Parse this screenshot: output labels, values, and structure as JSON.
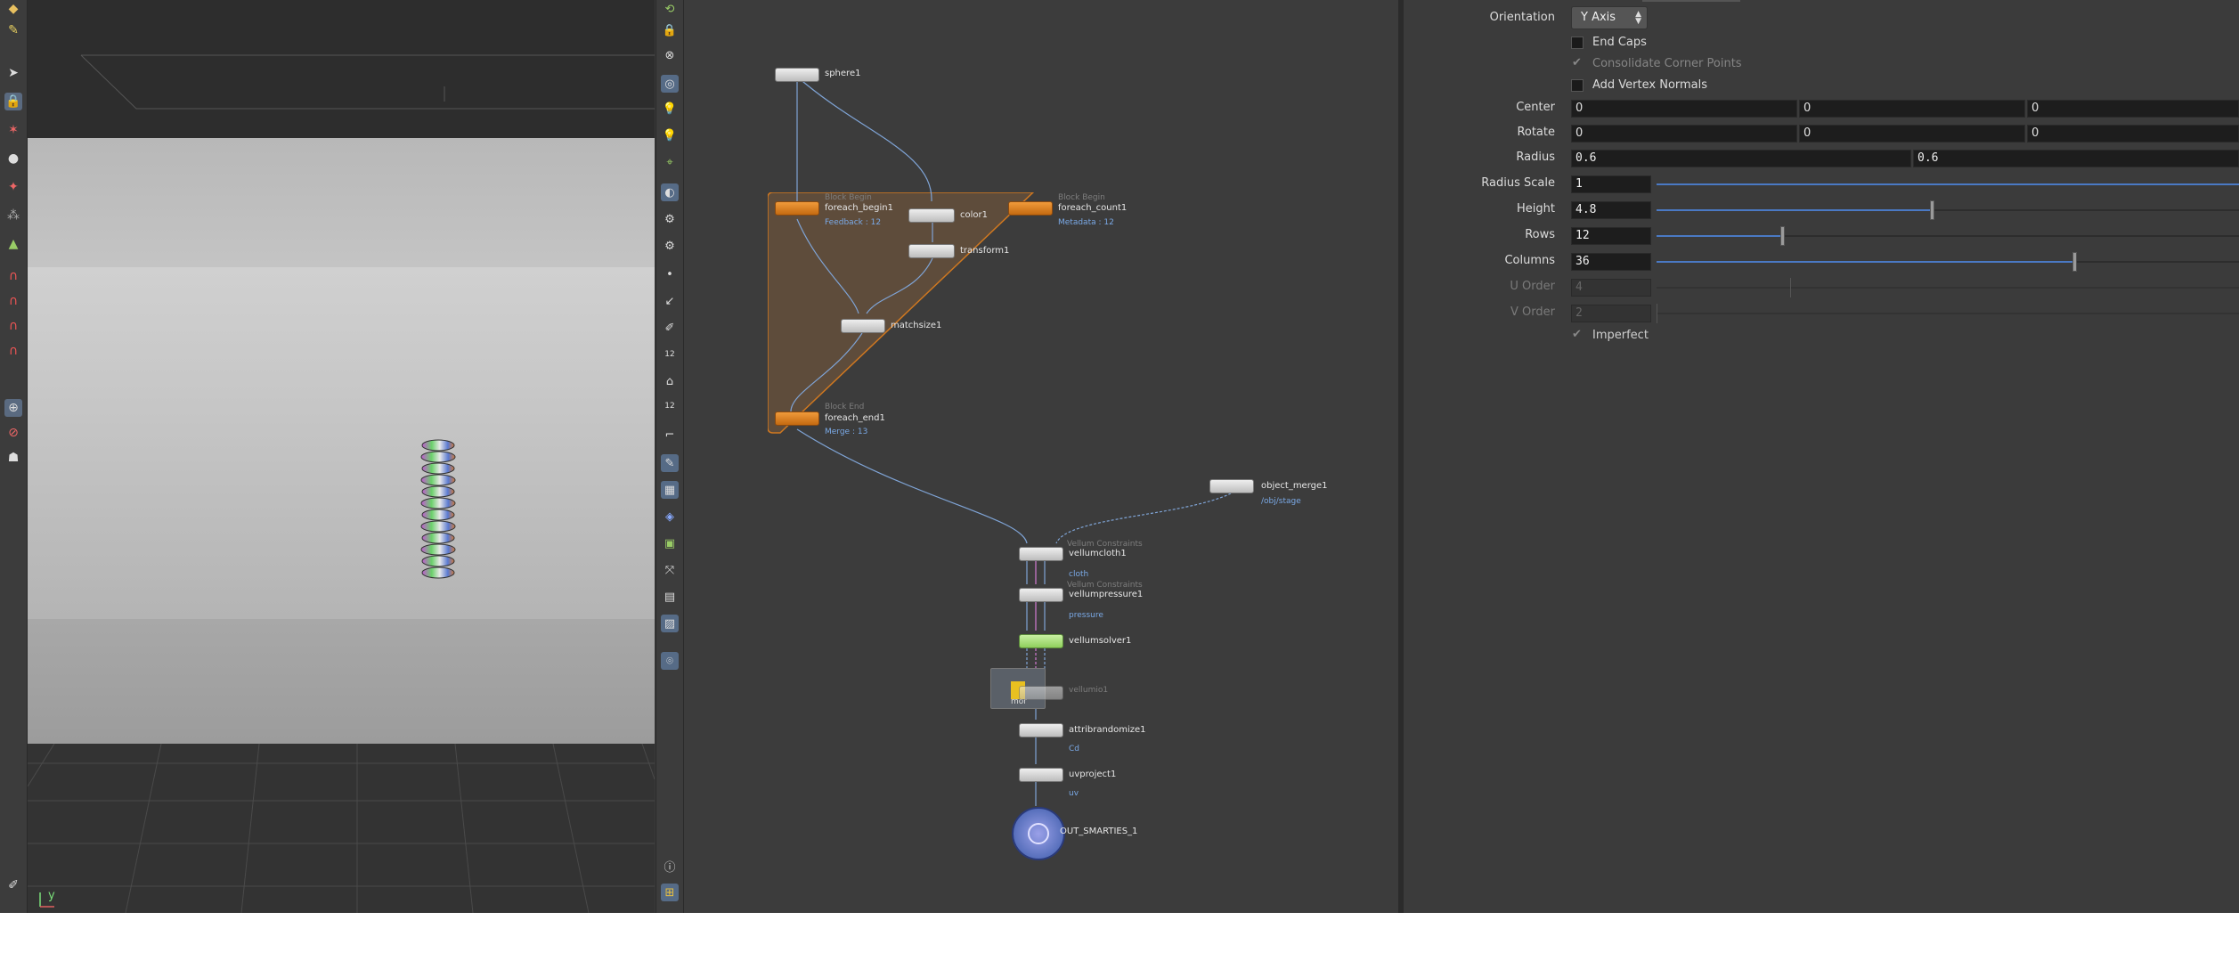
{
  "left_toolbar": {
    "icons": [
      "smooth-icon",
      "paint-icon",
      "select-arrow-icon",
      "lock-icon",
      "snap-magnet-icon",
      "sphere-tool-icon",
      "bone-icon",
      "particle-icon",
      "move-icon",
      "magnet-icon",
      "curve-magnet-icon",
      "gear-magnet-icon",
      "drop-icon",
      "hand-icon",
      "rivet-icon",
      "capture-icon",
      "pin-icon"
    ]
  },
  "viewport": {
    "axis_label": "y"
  },
  "viewport_toolbar": {
    "number_badges": [
      "12",
      "12"
    ],
    "icons": [
      "rotate-icon",
      "lock-icon",
      "close-icon",
      "circle-icon",
      "light-icon",
      "light2-icon",
      "camera-pin-icon",
      "shading-icon",
      "wire-icon",
      "display-icon",
      "point-icon",
      "normal-icon",
      "vector-icon",
      "number-icon",
      "brush-icon",
      "number2-icon",
      "crop-icon",
      "handle-icon",
      "texture-icon",
      "diamond-icon",
      "image-icon",
      "split-icon",
      "box-icon",
      "bg-icon",
      "map-pin-icon",
      "info-icon",
      "grid-icon"
    ]
  },
  "network": {
    "nodes": {
      "sphere1": {
        "label": "sphere1"
      },
      "foreach_begin1": {
        "label": "foreach_begin1",
        "header": "Block Begin",
        "sub": "Feedback : 12"
      },
      "color1": {
        "label": "color1"
      },
      "foreach_count1": {
        "label": "foreach_count1",
        "header": "Block Begin",
        "sub": "Metadata : 12"
      },
      "transform1": {
        "label": "transform1"
      },
      "matchsize1": {
        "label": "matchsize1"
      },
      "foreach_end1": {
        "label": "foreach_end1",
        "header": "Block End",
        "sub": "Merge : 13"
      },
      "object_merge1": {
        "label": "object_merge1",
        "sub": "/obj/stage"
      },
      "vellumcloth1": {
        "label": "vellumcloth1",
        "header": "Vellum Constraints",
        "sub": "cloth"
      },
      "vellumpressure1": {
        "label": "vellumpressure1",
        "header": "Vellum Constraints",
        "sub": "pressure"
      },
      "vellumsolver1": {
        "label": "vellumsolver1"
      },
      "vellumio1": {
        "label": "vellumio1",
        "sticky": "mor"
      },
      "attribrandomize1": {
        "label": "attribrandomize1",
        "sub": "Cd"
      },
      "uvproject1": {
        "label": "uvproject1",
        "sub": "uv"
      },
      "out": {
        "label": "OUT_SMARTIES_1"
      }
    }
  },
  "parameters": {
    "orientation": {
      "label": "Orientation",
      "value": "Y Axis"
    },
    "end_caps": {
      "label": "End Caps",
      "checked": false
    },
    "consolidate": {
      "label": "Consolidate Corner Points",
      "checked": true
    },
    "add_normals": {
      "label": "Add Vertex Normals",
      "checked": false
    },
    "center": {
      "label": "Center",
      "values": [
        "0",
        "0",
        "0"
      ]
    },
    "rotate": {
      "label": "Rotate",
      "values": [
        "0",
        "0",
        "0"
      ]
    },
    "radius": {
      "label": "Radius",
      "values": [
        "0.6",
        "0.6"
      ]
    },
    "radius_scale": {
      "label": "Radius Scale",
      "value": "1",
      "level": 1.0
    },
    "height": {
      "label": "Height",
      "value": "4.8",
      "level": 0.48
    },
    "rows": {
      "label": "Rows",
      "value": "12",
      "level": 0.18
    },
    "columns": {
      "label": "Columns",
      "value": "36",
      "level": 0.71
    },
    "u_order": {
      "label": "U Order",
      "value": "4"
    },
    "v_order": {
      "label": "V Order",
      "value": "2"
    },
    "imperfect": {
      "label": "Imperfect",
      "checked": true
    }
  }
}
